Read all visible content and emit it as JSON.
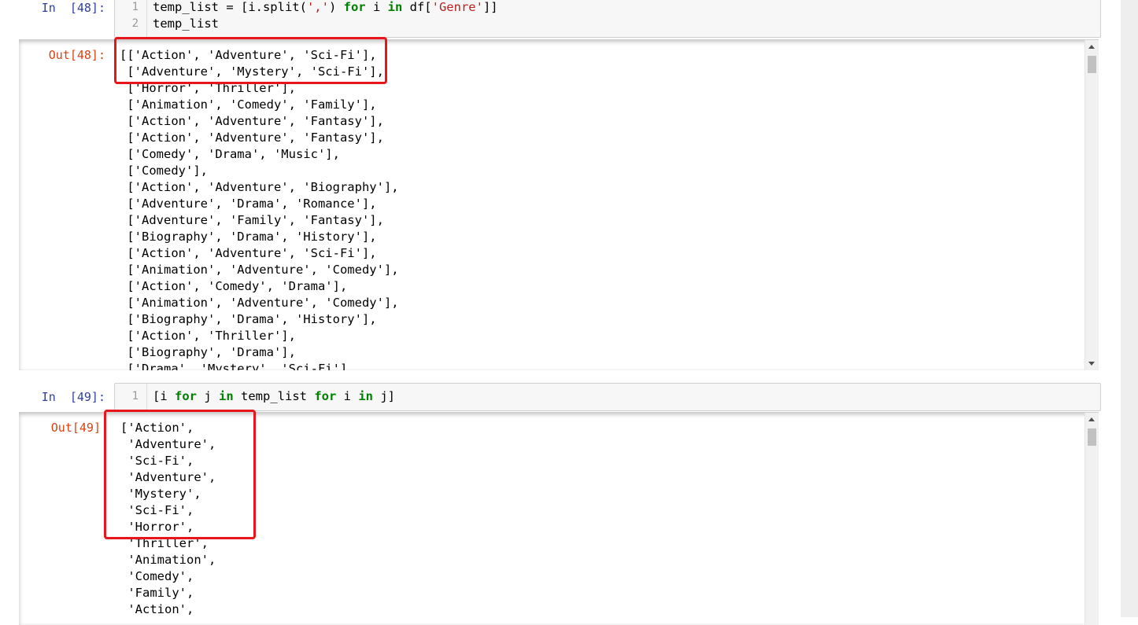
{
  "cells": [
    {
      "in_prompt": "In  [48]:",
      "out_prompt": "Out[48]:",
      "code_lines": [
        {
          "num": "1",
          "parts": [
            {
              "t": "temp_list = [i.split(",
              "c": "punct"
            },
            {
              "t": "','",
              "c": "str"
            },
            {
              "t": ") ",
              "c": "punct"
            },
            {
              "t": "for",
              "c": "kw"
            },
            {
              "t": " i ",
              "c": "punct"
            },
            {
              "t": "in",
              "c": "kw"
            },
            {
              "t": " df[",
              "c": "punct"
            },
            {
              "t": "'Genre'",
              "c": "str"
            },
            {
              "t": "]]",
              "c": "punct"
            }
          ]
        },
        {
          "num": "2",
          "parts": [
            {
              "t": "temp_list",
              "c": "punct"
            }
          ]
        }
      ],
      "output_lines": [
        "[['Action', 'Adventure', 'Sci-Fi'],",
        " ['Adventure', 'Mystery', 'Sci-Fi'],",
        " ['Horror', 'Thriller'],",
        " ['Animation', 'Comedy', 'Family'],",
        " ['Action', 'Adventure', 'Fantasy'],",
        " ['Action', 'Adventure', 'Fantasy'],",
        " ['Comedy', 'Drama', 'Music'],",
        " ['Comedy'],",
        " ['Action', 'Adventure', 'Biography'],",
        " ['Adventure', 'Drama', 'Romance'],",
        " ['Adventure', 'Family', 'Fantasy'],",
        " ['Biography', 'Drama', 'History'],",
        " ['Action', 'Adventure', 'Sci-Fi'],",
        " ['Animation', 'Adventure', 'Comedy'],",
        " ['Action', 'Comedy', 'Drama'],",
        " ['Animation', 'Adventure', 'Comedy'],",
        " ['Biography', 'Drama', 'History'],",
        " ['Action', 'Thriller'],",
        " ['Biography', 'Drama'],",
        " ['Drama', 'Mystery', 'Sci-Fi'],"
      ]
    },
    {
      "in_prompt": "In  [49]:",
      "out_prompt": "Out[49]",
      "code_lines": [
        {
          "num": "1",
          "parts": [
            {
              "t": "[i ",
              "c": "punct"
            },
            {
              "t": "for",
              "c": "kw"
            },
            {
              "t": " j ",
              "c": "punct"
            },
            {
              "t": "in",
              "c": "kw"
            },
            {
              "t": " temp_list ",
              "c": "punct"
            },
            {
              "t": "for",
              "c": "kw"
            },
            {
              "t": " i ",
              "c": "punct"
            },
            {
              "t": "in",
              "c": "kw"
            },
            {
              "t": " j]",
              "c": "punct"
            }
          ]
        }
      ],
      "output_lines": [
        "['Action',",
        " 'Adventure',",
        " 'Sci-Fi',",
        " 'Adventure',",
        " 'Mystery',",
        " 'Sci-Fi',",
        " 'Horror',",
        " 'Thriller',",
        " 'Animation',",
        " 'Comedy',",
        " 'Family',",
        " 'Action',"
      ]
    }
  ],
  "colors": {
    "highlight": "#e8161c",
    "keyword": "#008000",
    "string": "#ba2121",
    "in_prompt": "#303f9f",
    "out_prompt": "#d84315"
  }
}
